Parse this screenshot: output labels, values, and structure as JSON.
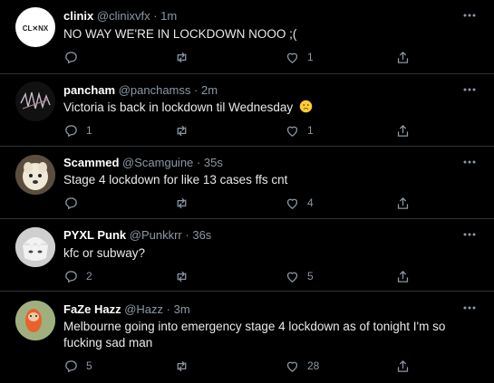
{
  "tweets": [
    {
      "display_name": "clinix",
      "handle": "@clinixvfx",
      "time": "1m",
      "text": "NO WAY WE'RE IN LOCKDOWN NOOO ;(",
      "replies": "",
      "retweets": "",
      "likes": "1",
      "avatar_text": "CL X NX"
    },
    {
      "display_name": "pancham",
      "handle": "@panchamss",
      "time": "2m",
      "text": "Victoria is back in lockdown til Wednesday",
      "text_emoji": "slightly-frowning-face",
      "replies": "1",
      "retweets": "",
      "likes": "1"
    },
    {
      "display_name": "Scammed",
      "handle": "@Scamguine",
      "time": "35s",
      "text": "Stage 4 lockdown for like 13 cases ffs cnt",
      "replies": "",
      "retweets": "",
      "likes": "4"
    },
    {
      "display_name": "PYXL Punk",
      "handle": "@Punkkrr",
      "time": "36s",
      "text": "kfc or subway?",
      "replies": "2",
      "retweets": "",
      "likes": "5"
    },
    {
      "display_name": "FaZe Hazz",
      "handle": "@Hazz",
      "time": "3m",
      "text_line1": "Melbourne going into emergency stage 4 lockdown as of tonight I'm so",
      "text_line2": "fucking sad man",
      "replies": "5",
      "retweets": "",
      "likes": "28"
    }
  ],
  "separator": "·",
  "icons": [
    "reply-icon",
    "retweet-icon",
    "like-icon",
    "share-icon",
    "more-icon"
  ],
  "colors": {
    "background": "#000000",
    "text": "#e7e9ea",
    "muted": "#8b98a5",
    "divider": "#2f3336"
  }
}
